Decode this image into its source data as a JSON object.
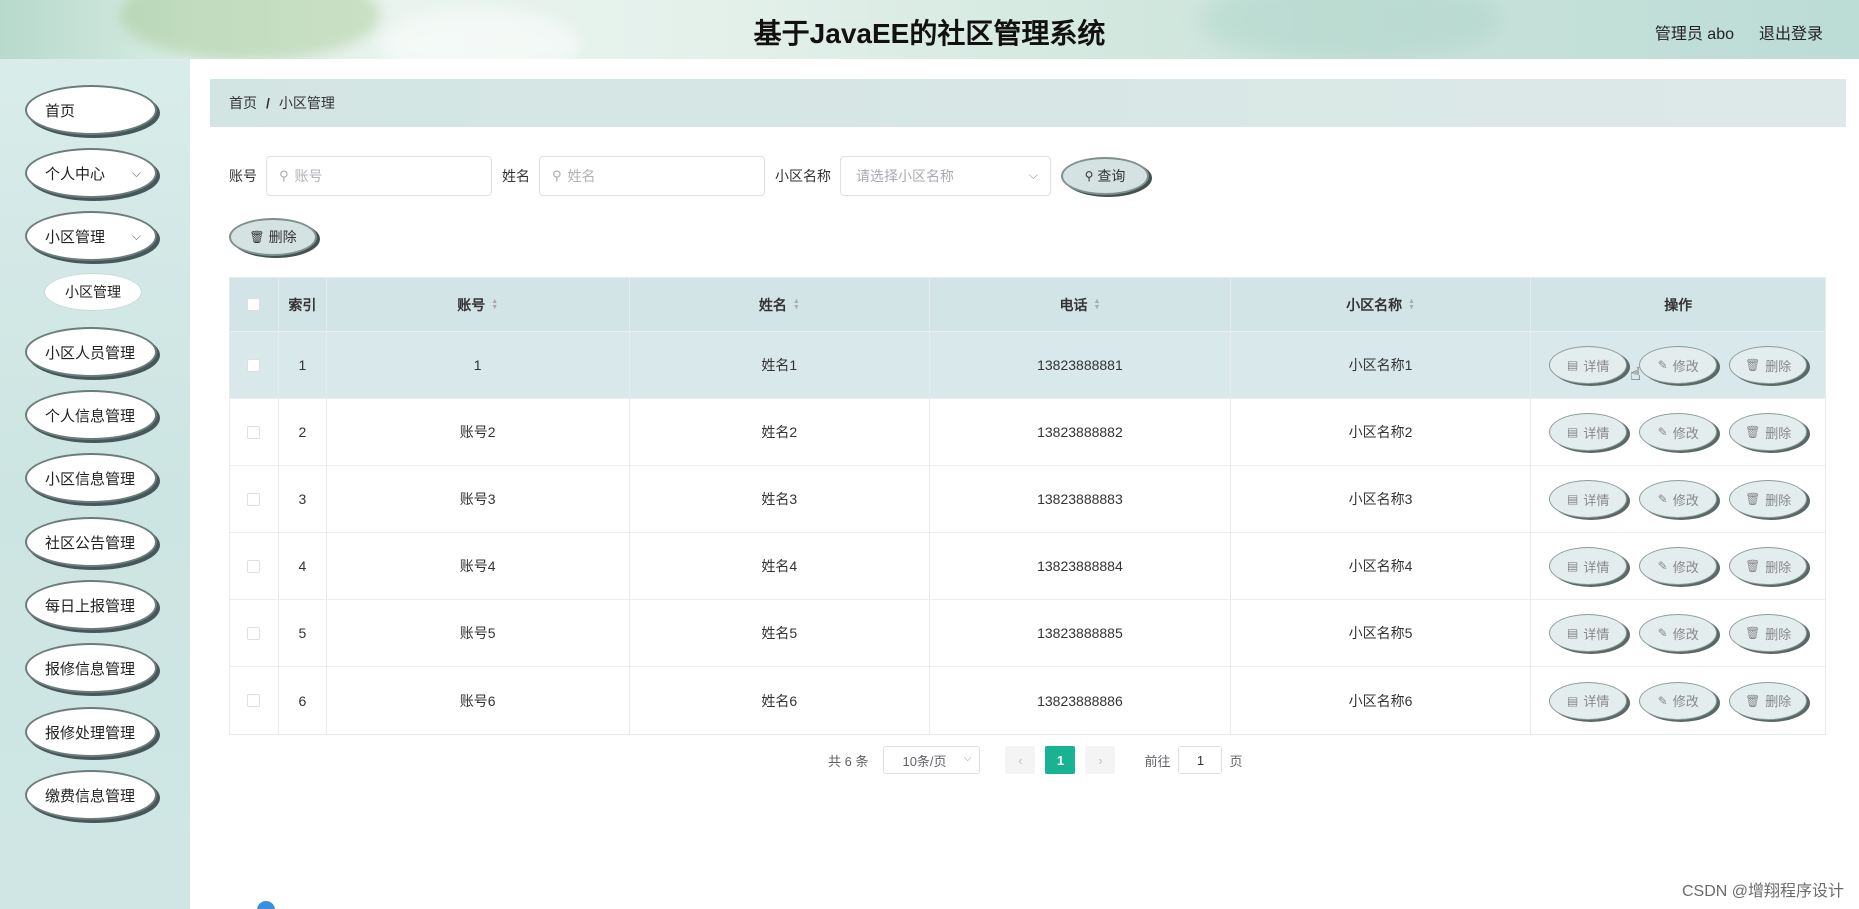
{
  "header": {
    "title": "基于JavaEE的社区管理系统",
    "admin": "管理员 abo",
    "logout": "退出登录"
  },
  "sidebar": {
    "items": [
      {
        "label": "首页"
      },
      {
        "label": "个人中心"
      },
      {
        "label": "小区管理"
      },
      {
        "label": "小区人员管理"
      },
      {
        "label": "个人信息管理"
      },
      {
        "label": "小区信息管理"
      },
      {
        "label": "社区公告管理"
      },
      {
        "label": "每日上报管理"
      },
      {
        "label": "报修信息管理"
      },
      {
        "label": "报修处理管理"
      },
      {
        "label": "缴费信息管理"
      }
    ],
    "submenu": {
      "label": "小区管理"
    }
  },
  "breadcrumb": {
    "home": "首页",
    "current": "小区管理"
  },
  "search": {
    "account_label": "账号",
    "account_placeholder": "账号",
    "name_label": "姓名",
    "name_placeholder": "姓名",
    "community_label": "小区名称",
    "community_placeholder": "请选择小区名称",
    "search_button": "查询"
  },
  "toolbar": {
    "delete_button": "删除"
  },
  "table": {
    "headers": {
      "index": "索引",
      "account": "账号",
      "name": "姓名",
      "phone": "电话",
      "community": "小区名称",
      "actions": "操作"
    },
    "rows": [
      {
        "index": "1",
        "account": "1",
        "name": "姓名1",
        "phone": "13823888881",
        "community": "小区名称1"
      },
      {
        "index": "2",
        "account": "账号2",
        "name": "姓名2",
        "phone": "13823888882",
        "community": "小区名称2"
      },
      {
        "index": "3",
        "account": "账号3",
        "name": "姓名3",
        "phone": "13823888883",
        "community": "小区名称3"
      },
      {
        "index": "4",
        "account": "账号4",
        "name": "姓名4",
        "phone": "13823888884",
        "community": "小区名称4"
      },
      {
        "index": "5",
        "account": "账号5",
        "name": "姓名5",
        "phone": "13823888885",
        "community": "小区名称5"
      },
      {
        "index": "6",
        "account": "账号6",
        "name": "姓名6",
        "phone": "13823888886",
        "community": "小区名称6"
      }
    ],
    "actions": {
      "detail": "详情",
      "edit": "修改",
      "delete": "删除"
    }
  },
  "pagination": {
    "total": "共 6 条",
    "page_size": "10条/页",
    "current": "1",
    "goto_prefix": "前往",
    "goto_value": "1",
    "goto_suffix": "页"
  },
  "watermark": "CSDN @增翔程序设计",
  "colors": {
    "accent": "#19b394",
    "header_row": "#d3e4e6",
    "sidebar_bg": "#cde5e2"
  }
}
